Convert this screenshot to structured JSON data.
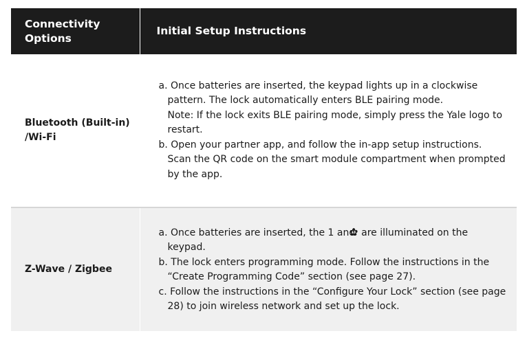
{
  "header": {
    "col1": "Connectivity Options",
    "col2": "Initial Setup Instructions"
  },
  "rows": [
    {
      "option": "Bluetooth (Built-in) /Wi-Fi",
      "items": [
        "a. Once batteries are inserted, the keypad lights up in a clockwise pattern. The lock automatically enters BLE pairing mode.",
        "Note: If the lock exits BLE pairing mode, simply press the Yale logo to restart.",
        "b. Open your partner app, and follow the in-app setup instructions. Scan the QR code on the smart module compartment when prompted by the app."
      ]
    },
    {
      "option": "Z-Wave / Zigbee",
      "items": [
        {
          "before": "a. Once batteries are inserted, the 1 and",
          "icon": "gear-icon",
          "after": "are illuminated on the keypad."
        },
        "b. The lock enters programming mode. Follow the instructions in the “Create Programming Code” section (see page 27).",
        "c. Follow the instructions in the “Configure Your Lock” section (see page 28) to join wireless network and set up the lock."
      ]
    }
  ]
}
